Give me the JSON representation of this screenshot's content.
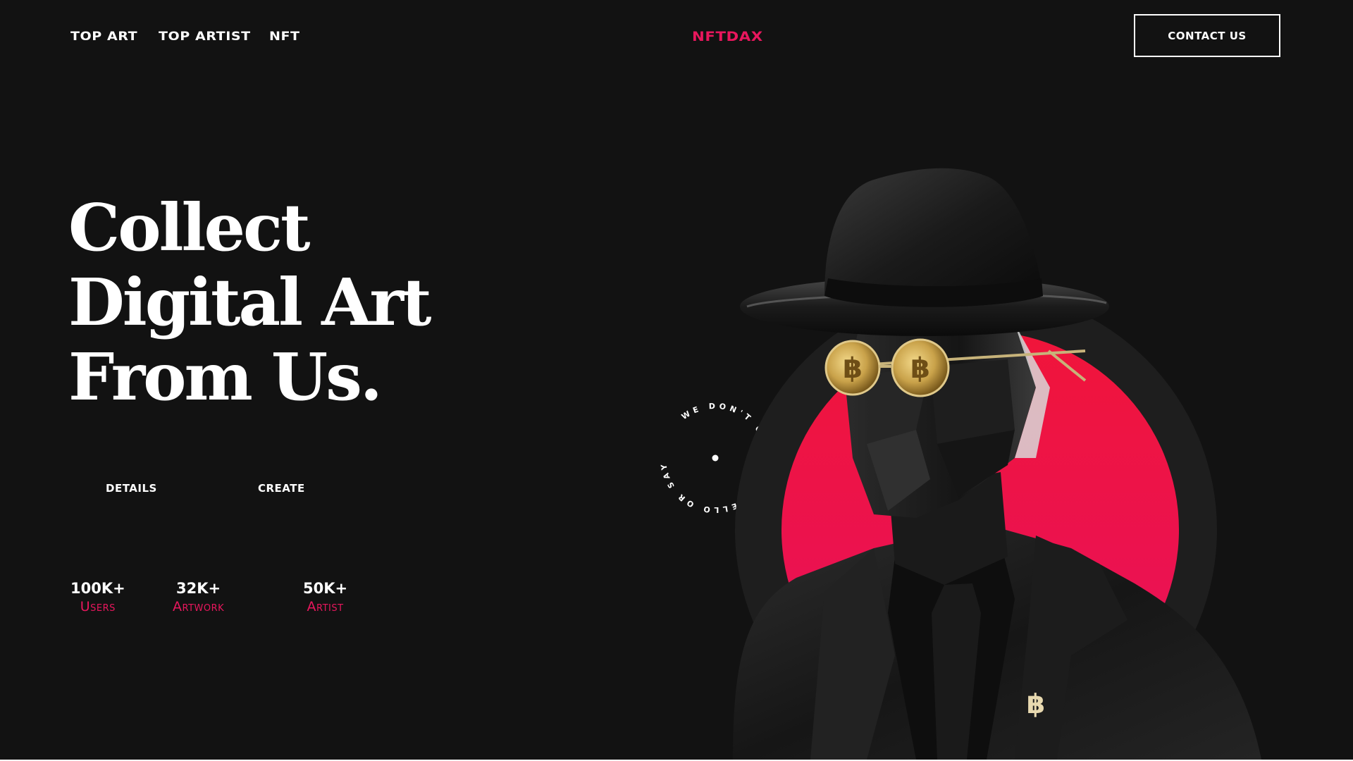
{
  "header": {
    "nav": [
      "TOP ART",
      "TOP ARTIST",
      "NFT"
    ],
    "brand": "NFTDAX",
    "contact_label": "CONTACT US"
  },
  "hero": {
    "title_lines": [
      "Collect",
      "Digital Art",
      "From Us."
    ],
    "buttons": [
      "DETAILS",
      "CREATE"
    ]
  },
  "stats": [
    {
      "value": "100K+",
      "label": "Users"
    },
    {
      "value": "32K+",
      "label": "Artwork"
    },
    {
      "value": "50K+",
      "label": "Artist"
    }
  ],
  "badge": {
    "circle_text": "WE DON'T CARE SAY HELLO OR SAY HI - "
  },
  "artwork": {
    "pin_symbol": "฿",
    "icons": [
      "fedora-hat-icon",
      "bitcoin-glasses-icon",
      "bitcoin-pin-icon"
    ]
  },
  "colors": {
    "background": "#121212",
    "accent": "#e8175d",
    "text": "#ffffff"
  }
}
